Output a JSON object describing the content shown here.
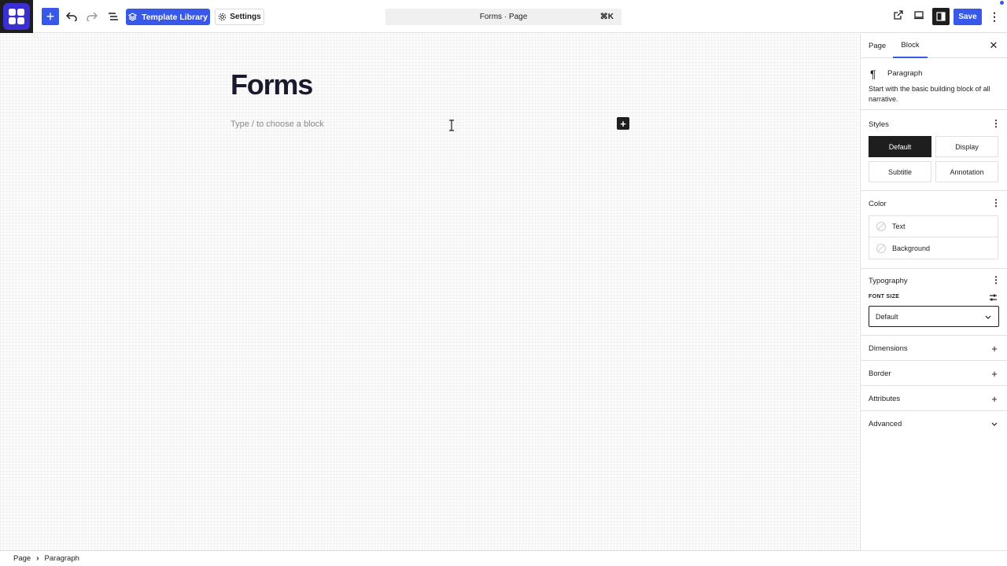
{
  "toolbar": {
    "template_library_label": "Template Library",
    "settings_label": "Settings",
    "command_title": "Forms · Page",
    "command_shortcut": "⌘K",
    "save_label": "Save"
  },
  "editor": {
    "title": "Forms",
    "placeholder": "Type / to choose a block"
  },
  "sidebar": {
    "tabs": [
      "Page",
      "Block"
    ],
    "active_tab": "Block",
    "block": {
      "name": "Paragraph",
      "description": "Start with the basic building block of all narrative."
    },
    "styles": {
      "header": "Styles",
      "options": [
        "Default",
        "Display",
        "Subtitle",
        "Annotation"
      ],
      "selected": "Default"
    },
    "color": {
      "header": "Color",
      "items": [
        "Text",
        "Background"
      ]
    },
    "typography": {
      "header": "Typography",
      "font_size_label": "FONT SIZE",
      "font_size_value": "Default"
    },
    "panels": [
      "Dimensions",
      "Border",
      "Attributes",
      "Advanced"
    ]
  },
  "breadcrumb": [
    "Page",
    "Paragraph"
  ],
  "colors": {
    "accent": "#3858e9",
    "logo_bg": "#1e1e1e",
    "logo_tile": "#3a2fd1"
  }
}
